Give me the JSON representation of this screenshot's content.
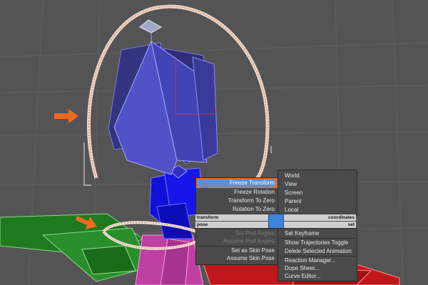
{
  "quad_menu": {
    "top_left": {
      "items": [
        {
          "label": "Freeze Transform",
          "highlighted": true
        },
        {
          "label": "Freeze Rotation"
        },
        {
          "label": "Transform To Zero"
        },
        {
          "label": "Rotation To Zero"
        }
      ],
      "title": "transform"
    },
    "top_right": {
      "items": [
        "World",
        "View",
        "Screen",
        "Parent",
        "Local"
      ],
      "title": "coordinates"
    },
    "bottom_left": {
      "title": "pose",
      "items": [
        {
          "label": "Set Pref Angles",
          "disabled": true
        },
        {
          "label": "Assume Pref Angles",
          "disabled": true
        },
        {
          "label": "Set as Skin Pose"
        },
        {
          "label": "Assume Skin Pose"
        }
      ]
    },
    "bottom_right": {
      "title": "set",
      "items": [
        "Set Keyframe",
        "Show Trajectories Toggle",
        "Delete Selected Animation",
        "Reaction Manager...",
        "Dope Sheet...",
        "Curve Editor..."
      ]
    }
  },
  "colors": {
    "viewport_bg": "#555555",
    "menu_bg": "#4a4a4a",
    "highlight": "#5a8fd6",
    "highlight_border": "#f06a1e",
    "annotation_arrow": "#f06a1e"
  }
}
